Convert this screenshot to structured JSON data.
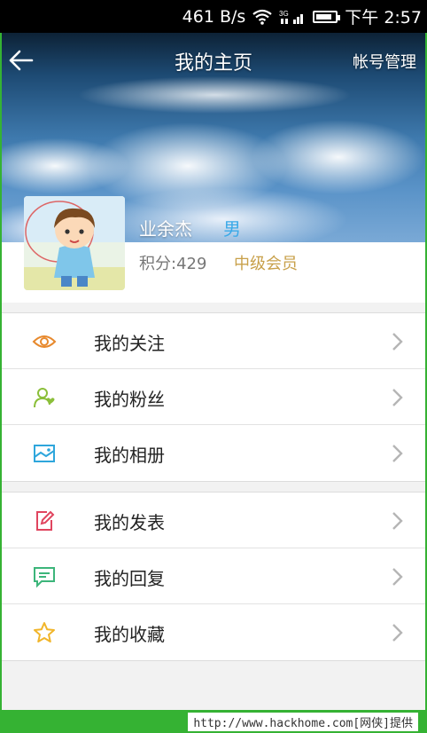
{
  "status_bar": {
    "speed": "461 B/s",
    "network": "3G",
    "time": "下午 2:57",
    "battery_level": 0.85
  },
  "nav": {
    "title": "我的主页",
    "account": "帐号管理"
  },
  "profile": {
    "username": "业余杰",
    "gender": "男",
    "points": "积分:429",
    "level": "中级会员"
  },
  "menu_group_1": [
    {
      "label": "我的关注",
      "icon": "eye-icon",
      "color": "#e7892d"
    },
    {
      "label": "我的粉丝",
      "icon": "user-heart-icon",
      "color": "#8bbf3a"
    },
    {
      "label": "我的相册",
      "icon": "photo-icon",
      "color": "#2ea6dc"
    }
  ],
  "menu_group_2": [
    {
      "label": "我的发表",
      "icon": "edit-icon",
      "color": "#e0455f"
    },
    {
      "label": "我的回复",
      "icon": "comment-icon",
      "color": "#3cb57a"
    },
    {
      "label": "我的收藏",
      "icon": "star-icon",
      "color": "#f1b52a"
    }
  ],
  "footer": {
    "watermark": "http://www.hackhome.com[网侠]提供"
  }
}
